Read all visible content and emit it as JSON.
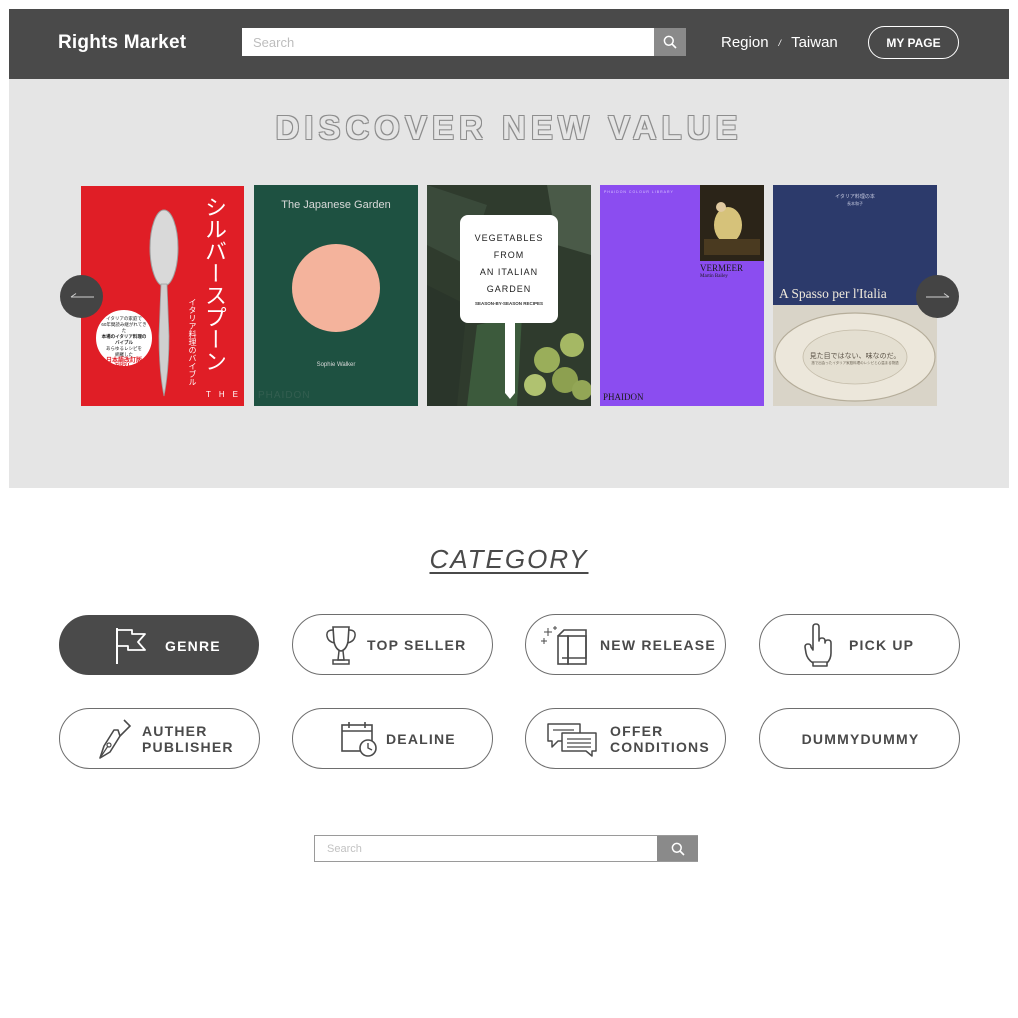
{
  "header": {
    "logo": "Rights Market",
    "search_placeholder": "Search",
    "region_label": "Region",
    "region_separator": "/",
    "region_value": "Taiwan",
    "mypage_label": "MY PAGE"
  },
  "hero": {
    "title": "DISCOVER NEW VALUE",
    "books": [
      {
        "title_lines": [
          "シルバースプーン",
          "イタリア料理のバイブル"
        ],
        "badge": [
          "イタリアの家庭で",
          "60年間読み継がれてきた",
          "本場のイタリア料理の",
          "バイブル",
          "あらゆるレシピを",
          "網羅した",
          "日本語改訂版",
          "刊行！"
        ],
        "spine": "THE",
        "color": "#e01e26"
      },
      {
        "title": "The Japanese Garden",
        "author": "Sophie Walker",
        "publisher": "PHAIDON",
        "color": "#1e5141"
      },
      {
        "title_lines": [
          "VEGETABLES",
          "FROM",
          "AN ITALIAN",
          "GARDEN"
        ],
        "subtitle": "SEASON-BY-SEASON RECIPES",
        "color": "#3b4a3a"
      },
      {
        "series": "PHAIDON COLOUR LIBRARY",
        "title": "VERMEER",
        "author": "Martin Bailey",
        "publisher": "PHAIDON",
        "color": "#8b4df0"
      },
      {
        "header": "イタリア料理の本",
        "author": "長本和子",
        "title": "A Spasso per l'Italia",
        "caption": "見た目ではない、味なのだ。",
        "caption2": "旅で出会ったイタリア家庭料理のレシピと心温まる物語",
        "color": "#2c3a6b"
      }
    ]
  },
  "category": {
    "title": "CATEGORY",
    "items": [
      {
        "label": "GENRE",
        "icon": "flag-icon",
        "active": true
      },
      {
        "label": "TOP SELLER",
        "icon": "trophy-icon",
        "active": false
      },
      {
        "label": "NEW RELEASE",
        "icon": "new-book-icon",
        "active": false
      },
      {
        "label": "PICK UP",
        "icon": "pointing-hand-icon",
        "active": false
      },
      {
        "label_lines": [
          "AUTHER",
          "PUBLISHER"
        ],
        "icon": "fountain-pen-icon",
        "active": false
      },
      {
        "label": "DEALINE",
        "icon": "calendar-clock-icon",
        "active": false
      },
      {
        "label_lines": [
          "OFFER",
          "CONDITIONS"
        ],
        "icon": "speech-bubbles-icon",
        "active": false
      },
      {
        "label": "DUMMYDUMMY",
        "active": false
      }
    ]
  },
  "bottom_search": {
    "placeholder": "Search"
  },
  "colors": {
    "header_bg": "#4a4a4a",
    "hero_bg": "#e5e5e5",
    "accent": "#4a4a4a"
  }
}
